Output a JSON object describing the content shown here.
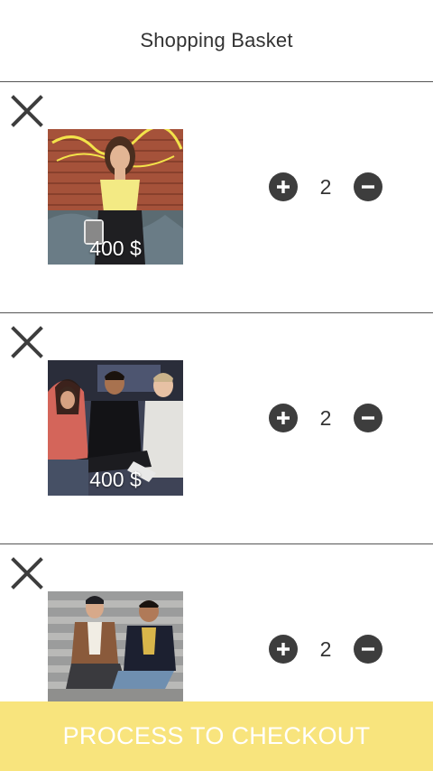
{
  "header": {
    "title": "Shopping Basket"
  },
  "colors": {
    "accent": "#f8e47d",
    "icon": "#3d3d3d",
    "divider": "#555555"
  },
  "icons": {
    "remove": "close-icon",
    "increase": "plus-circle-icon",
    "decrease": "minus-circle-icon"
  },
  "basket": {
    "items": [
      {
        "price": "400 $",
        "quantity": "2",
        "image": "woman-brick-wall-photo"
      },
      {
        "price": "400 $",
        "quantity": "2",
        "image": "three-friends-photo"
      },
      {
        "price": "",
        "quantity": "2",
        "image": "two-men-stairs-photo"
      }
    ]
  },
  "checkout": {
    "label": "PROCESS TO CHECKOUT"
  }
}
